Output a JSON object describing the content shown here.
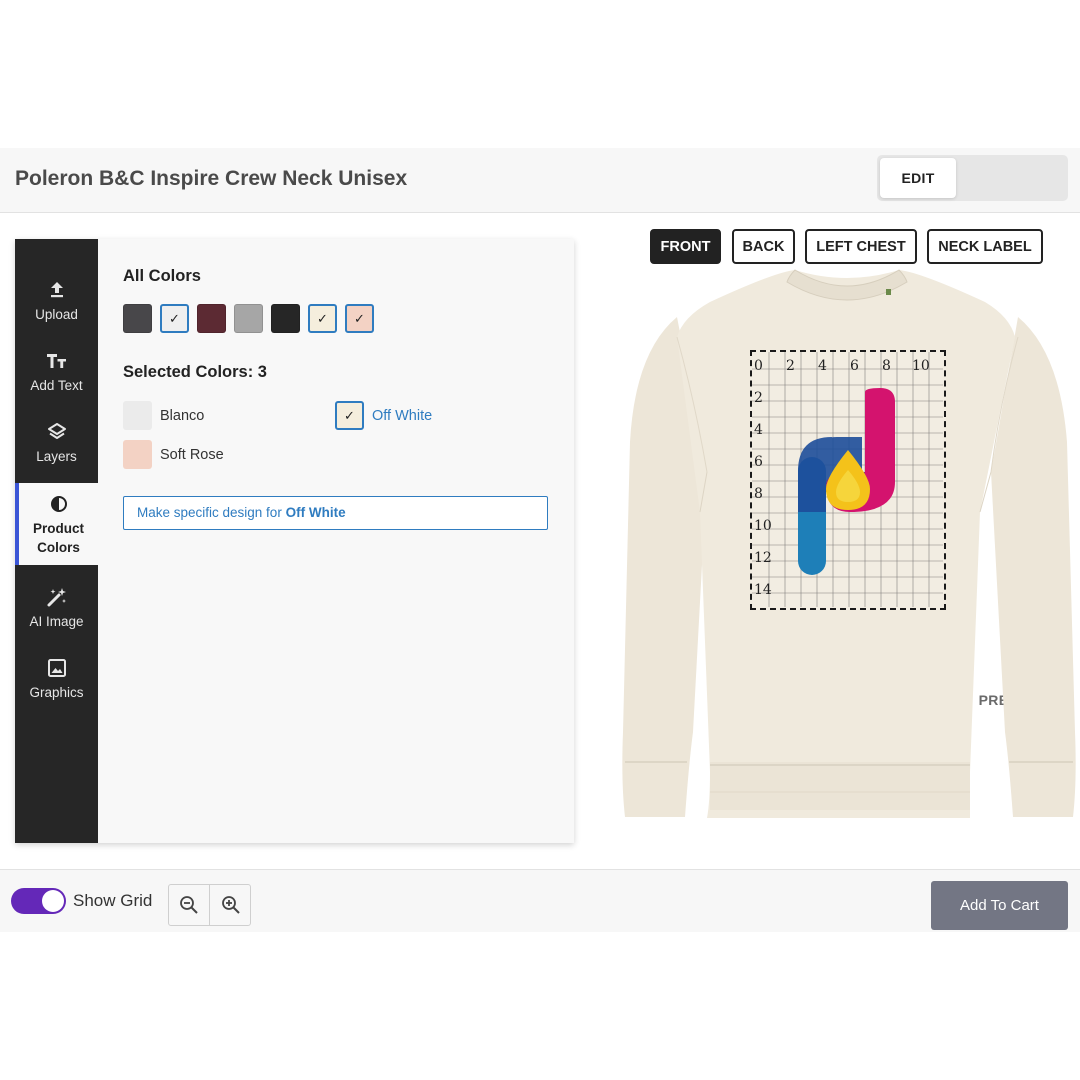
{
  "header": {
    "title": "Poleron B&C Inspire Crew Neck Unisex",
    "mode_edit": "EDIT",
    "mode_preview": "PREVIEW"
  },
  "sidebar": {
    "items": [
      {
        "label": "Upload",
        "icon": "upload-icon"
      },
      {
        "label": "Add Text",
        "icon": "text-icon"
      },
      {
        "label": "Layers",
        "icon": "layers-icon"
      },
      {
        "label": "Product Colors",
        "icon": "contrast-icon",
        "active": true
      },
      {
        "label": "AI Image",
        "icon": "magic-wand-icon"
      },
      {
        "label": "Graphics",
        "icon": "image-icon"
      }
    ]
  },
  "colors": {
    "all_title": "All Colors",
    "swatches": [
      {
        "hex": "#48474a",
        "selected": false
      },
      {
        "hex": "#efefef",
        "selected": true
      },
      {
        "hex": "#5c2a33",
        "selected": false
      },
      {
        "hex": "#a6a6a6",
        "selected": false
      },
      {
        "hex": "#262626",
        "selected": false
      },
      {
        "hex": "#f5eedd",
        "selected": true
      },
      {
        "hex": "#f3d2c4",
        "selected": true
      }
    ],
    "selected_title": "Selected Colors: 3",
    "selected": [
      {
        "name": "Blanco",
        "hex": "#ebebeb"
      },
      {
        "name": "Off White",
        "hex": "#f5eedd",
        "active": true
      },
      {
        "name": "Soft Rose",
        "hex": "#f3d2c4"
      }
    ],
    "design_prefix": "Make specific design for",
    "design_color": "Off White"
  },
  "views": [
    "FRONT",
    "BACK",
    "LEFT CHEST",
    "NECK LABEL"
  ],
  "active_view": "FRONT",
  "garment_color": "#f0eadd",
  "grid": {
    "x_ticks": [
      "0",
      "2",
      "4",
      "6",
      "8",
      "10"
    ],
    "y_ticks": [
      "2",
      "4",
      "6",
      "8",
      "10",
      "12",
      "14"
    ]
  },
  "bottom": {
    "show_grid_label": "Show Grid",
    "show_grid": true,
    "cart_label": "Add To Cart"
  },
  "accent": "#3a55d6",
  "toggle_color": "#6428b8",
  "link_color": "#2f7cc0"
}
